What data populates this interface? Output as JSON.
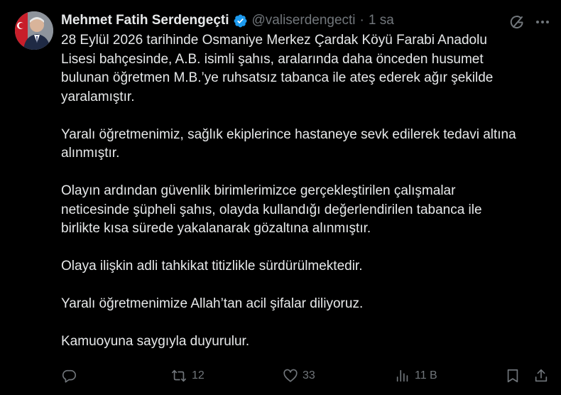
{
  "colors": {
    "background": "#000000",
    "text": "#e7e9ea",
    "secondary": "#71767b",
    "verified_badge": "#1d9bf0"
  },
  "author": {
    "display_name": "Mehmet Fatih Serdengeçti",
    "handle": "@valiserdengecti",
    "separator": "·",
    "time": "1 sa",
    "verified": true,
    "avatar_icon": "avatar-portrait"
  },
  "tweet": {
    "paragraphs": [
      "28 Eylül 2026 tarihinde Osmaniye Merkez Çardak Köyü Farabi Anadolu\nLisesi bahçesinde, A.B. isimli şahıs, aralarında daha önceden husumet\nbulunan öğretmen M.B.’ye ruhsatsız tabanca ile ateş ederek ağır şekilde\nyaralamıştır.",
      "Yaralı öğretmenimiz, sağlık ekiplerince hastaneye sevk edilerek tedavi altına\nalınmıştır.",
      "Olayın ardından güvenlik birimlerimizce gerçekleştirilen çalışmalar\nneticesinde şüpheli şahıs, olayda kullandığı değerlendirilen tabanca ile\nbirlikte kısa sürede yakalanarak gözaltına alınmıştır.",
      "Olaya ilişkin adli tahkikat titizlikle sürdürülmektedir.",
      "Yaralı öğretmenimize Allah’tan acil şifalar diliyoruz.",
      "Kamuoyuna saygıyla duyurulur."
    ]
  },
  "actions": {
    "reply": {
      "icon": "reply-icon",
      "count": ""
    },
    "repost": {
      "icon": "repost-icon",
      "count": "12"
    },
    "like": {
      "icon": "heart-icon",
      "count": "33"
    },
    "views": {
      "icon": "views-icon",
      "count": "11 B"
    },
    "bookmark": {
      "icon": "bookmark-icon"
    },
    "share": {
      "icon": "share-icon"
    }
  },
  "top_icons": {
    "grok": "grok-icon",
    "more": "more-icon"
  }
}
